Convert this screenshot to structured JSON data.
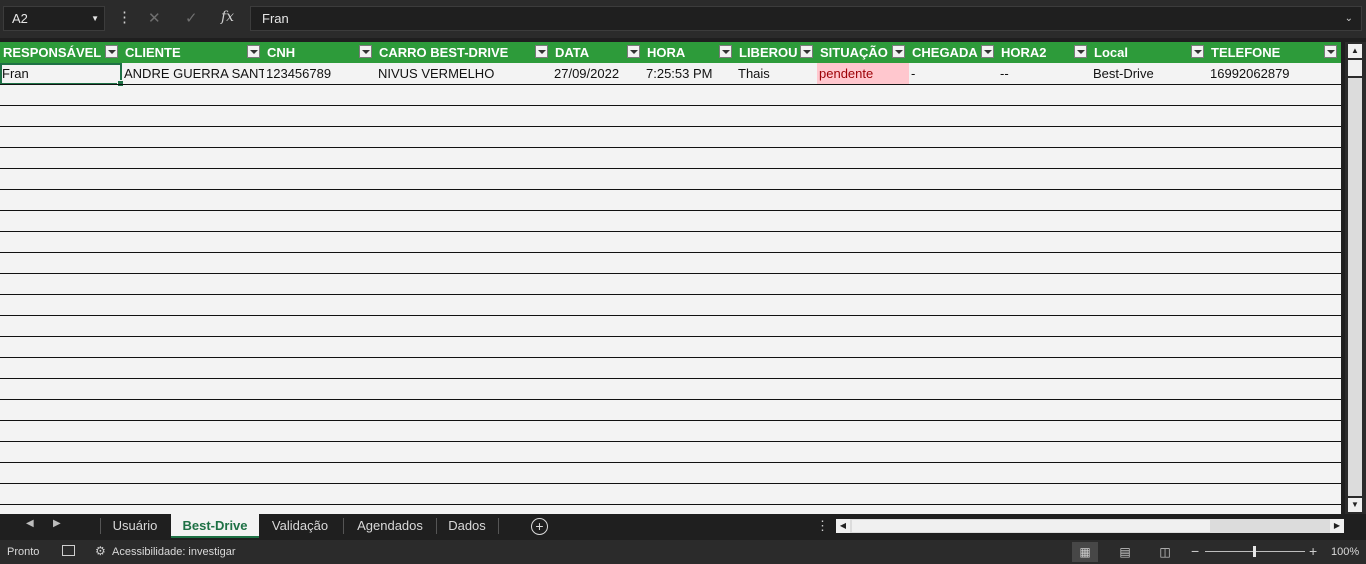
{
  "formula_bar": {
    "name_box": "A2",
    "formula": "Fran"
  },
  "table": {
    "headers": [
      "RESPONSÁVEL",
      "CLIENTE",
      "CNH",
      "CARRO BEST-DRIVE",
      "DATA",
      "HORA",
      "LIBEROU",
      "SITUAÇÃO",
      "CHEGADA",
      "HORA2",
      "Local",
      "TELEFONE"
    ],
    "rows": [
      [
        "Fran",
        "ANDRE GUERRA SANTOS",
        "123456789",
        "NIVUS VERMELHO",
        "27/09/2022",
        "7:25:53 PM",
        "Thais",
        "pendente",
        "-",
        "--",
        "Best-Drive",
        "16992062879"
      ]
    ]
  },
  "sheet_tabs": [
    "Usuário",
    "Best-Drive",
    "Validação",
    "Agendados",
    "Dados"
  ],
  "active_tab": "Best-Drive",
  "status": {
    "ready": "Pronto",
    "accessibility": "Acessibilidade: investigar",
    "zoom": "100%"
  },
  "colors": {
    "header_green": "#2d9b3a",
    "pending_fill": "#ffc7ce",
    "pending_text": "#9c0006",
    "selection": "#1e7145"
  }
}
